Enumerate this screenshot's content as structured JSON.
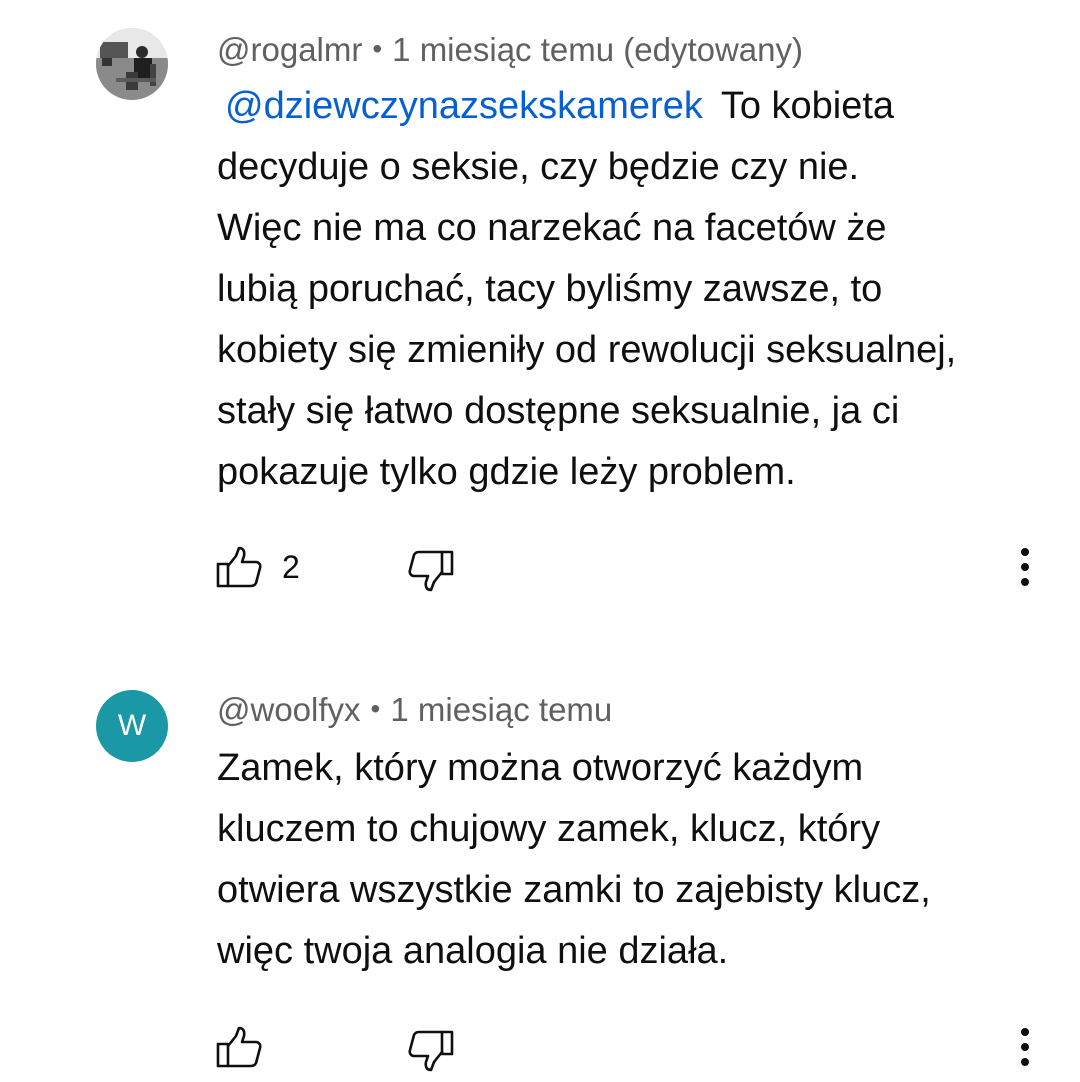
{
  "comments": [
    {
      "author": "@rogalmr",
      "separator": "•",
      "time": "1 miesiąc temu (edytowany)",
      "mention": "@dziewczynazsekskamerek",
      "lines": [
        "To kobieta",
        "decyduje o seksie, czy będzie czy nie.",
        "Więc nie ma co narzekać na facetów że",
        "lubią poruchać, tacy byliśmy zawsze, to",
        "kobiety się zmieniły od rewolucji seksualnej,",
        "stały się łatwo dostępne seksualnie, ja ci",
        "pokazuje tylko gdzie leży problem."
      ],
      "like_count": "2",
      "avatar": "photo-avatar"
    },
    {
      "author": "@woolfyx",
      "separator": "•",
      "time": "1 miesiąc temu",
      "avatar_letter": "W",
      "avatar_color": "#1a98a6",
      "lines": [
        "Zamek, który można otworzyć każdym",
        "kluczem to chujowy zamek, klucz, który",
        "otwiera wszystkie zamki to zajebisty klucz,",
        "więc twoja analogia nie działa."
      ],
      "like_count": ""
    }
  ],
  "icons": {
    "like": "thumbs-up-icon",
    "dislike": "thumbs-down-icon",
    "more": "more-vertical-icon"
  },
  "colors": {
    "mention": "#065fd4",
    "meta": "#606060",
    "text": "#0f0f0f"
  }
}
